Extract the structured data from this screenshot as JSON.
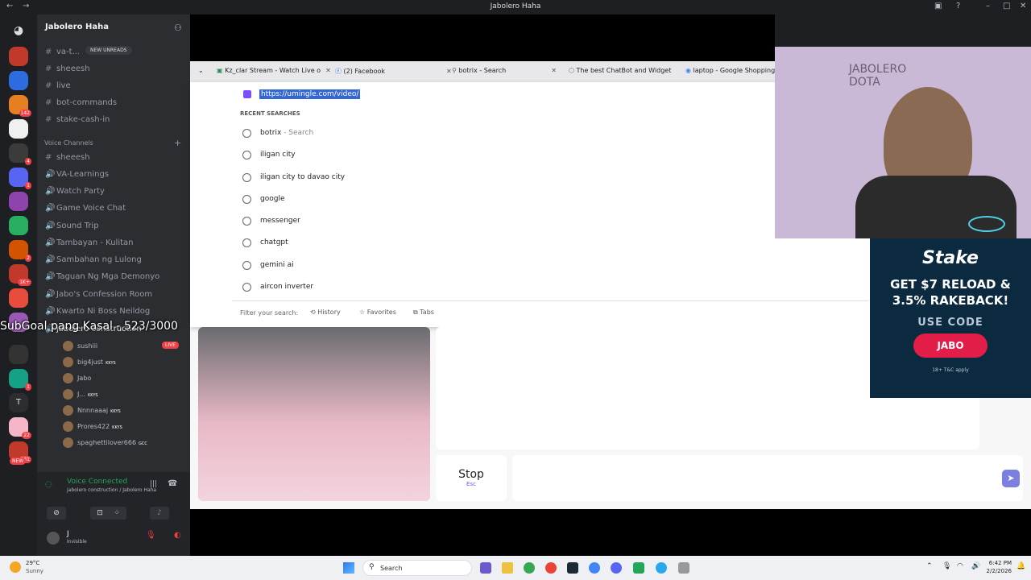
{
  "titlebar": {
    "title": "Jabolero Haha"
  },
  "server": {
    "name": "Jabolero Haha",
    "new_unreads": "NEW UNREADS",
    "text_channels": [
      "va-t...",
      "sheeesh",
      "live",
      "bot-commands",
      "stake-cash-in"
    ],
    "voice_header": "Voice Channels",
    "voice_channels": [
      "sheeesh",
      "VA-Learnings",
      "Watch Party",
      "Game Voice Chat",
      "Sound Trip",
      "Tambayan - Kulitan",
      "Sambahan ng Lulong",
      "Taguan Ng Mga Demonyo",
      "Jabo's Confession Room",
      "Kwarto Ni Boss Neildog",
      "jabolero construction"
    ],
    "voice_users": [
      {
        "name": "sushiii",
        "tag": "LIVE"
      },
      {
        "name": "big4just",
        "tag": "KKYS"
      },
      {
        "name": "Jabo",
        "tag": ""
      },
      {
        "name": "J...",
        "tag": "KKYS"
      },
      {
        "name": "Nnnnaaaj",
        "tag": "KKYS"
      },
      {
        "name": "Prores422",
        "tag": "KKYS"
      },
      {
        "name": "spaghettilover666",
        "tag": "GCC"
      }
    ],
    "voice_status": "Voice Connected",
    "voice_location": "jabolero construction / Jabolero Haha",
    "user_name": "J",
    "user_status": "Invisible"
  },
  "rail_badges": [
    "142",
    "4",
    "1",
    "2",
    "1K+",
    "1",
    "22",
    "231",
    "NEW"
  ],
  "overlay_text": "SubGoal pang Kasal - 523/3000",
  "browser": {
    "tabs": [
      {
        "label": "Kz_clar Stream - Watch Live o"
      },
      {
        "label": "(2) Facebook"
      },
      {
        "label": "botrix - Search"
      },
      {
        "label": "The best ChatBot and Widget"
      },
      {
        "label": "laptop - Google Shopping"
      }
    ],
    "url": "https://umingle.com/video/",
    "recent_header": "RECENT SEARCHES",
    "suggestions": [
      {
        "label": "botrix",
        "suffix": " - Search"
      },
      {
        "label": "iligan city",
        "suffix": ""
      },
      {
        "label": "iligan city to davao city",
        "suffix": ""
      },
      {
        "label": "google",
        "suffix": ""
      },
      {
        "label": "messenger",
        "suffix": ""
      },
      {
        "label": "chatgpt",
        "suffix": ""
      },
      {
        "label": "gemini ai",
        "suffix": ""
      },
      {
        "label": "aircon inverter",
        "suffix": ""
      }
    ],
    "filter_label": "Filter your search:",
    "filters": [
      "History",
      "Favorites",
      "Tabs"
    ],
    "stop_label": "Stop",
    "stop_hint": "Esc"
  },
  "webcam_watermark": "JABOLERO DOTA",
  "ad": {
    "brand": "Stake",
    "headline": "GET $7 RELOAD & 3.5% RAKEBACK!",
    "code_label": "USE CODE",
    "code": "JABO",
    "disclaimer": "18+ T&C apply"
  },
  "taskbar": {
    "weather_temp": "29°C",
    "weather_desc": "Sunny",
    "search": "Search",
    "time": "6:42 PM",
    "date": "2/2/2026"
  },
  "colors": {
    "discord_bg": "#2b2d31",
    "accent_green": "#23a55a",
    "stake_bg": "#0b2a3f"
  }
}
